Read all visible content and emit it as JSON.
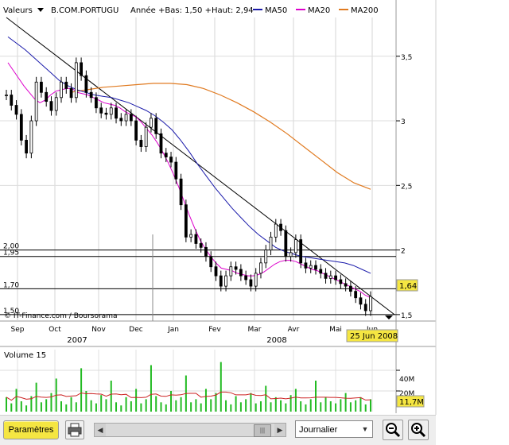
{
  "header": {
    "menu_label": "Valeurs",
    "symbol": "B.COM.PORTUGU",
    "range_text": "Année +Bas: 1,50 +Haut: 2,94",
    "ma50_label": "MA50",
    "ma20_label": "MA20",
    "ma200_label": "MA200"
  },
  "colors": {
    "price": "#000000",
    "ma50": "#1a1aaa",
    "ma20": "#dd00cc",
    "ma200": "#e07a20",
    "volume_bar": "#22bb22",
    "volume_ma": "#cc2222",
    "last_price_box": "#f5e642",
    "date_box": "#f5e642",
    "params_button": "#f5e642"
  },
  "icons": {
    "menu": "triangle-down-icon",
    "print": "printer-icon",
    "zoom_out": "zoom-out-icon",
    "zoom_in": "zoom-in-icon"
  },
  "chart_data": {
    "type": "line",
    "ylim": [
      1.45,
      3.8
    ],
    "y_ticks": [
      {
        "v": 3.5,
        "label": "3,5"
      },
      {
        "v": 3.0,
        "label": "3"
      },
      {
        "v": 2.5,
        "label": "2,5"
      },
      {
        "v": 2.0,
        "label": "2"
      },
      {
        "v": 1.5,
        "label": "1,5"
      }
    ],
    "h_levels": [
      {
        "v": 2.0,
        "label": "2,00"
      },
      {
        "v": 1.95,
        "label": "1,95"
      },
      {
        "v": 1.7,
        "label": "1,70"
      },
      {
        "v": 1.5,
        "label": "1,50"
      }
    ],
    "x_months": [
      "Sep",
      "Oct",
      "Nov",
      "Dec",
      "Jan",
      "Fev",
      "Mar",
      "Avr",
      "Mai",
      "Jun"
    ],
    "x_years": [
      {
        "label": "2007",
        "month_index": 1
      },
      {
        "label": "2008",
        "month_index": 6
      }
    ],
    "last_price_label": "1,64",
    "last_price": 1.64,
    "cursor_date_label": "25 Jun 2008",
    "source_label": "© IT-Finance.com / Boursorama",
    "price_series": {
      "name": "B.COM.PORTUGU",
      "values": [
        3.2,
        3.12,
        3.05,
        2.85,
        2.75,
        3.0,
        3.3,
        3.22,
        3.15,
        3.08,
        3.18,
        3.3,
        3.25,
        3.18,
        3.45,
        3.35,
        3.22,
        3.18,
        3.1,
        3.06,
        3.05,
        3.1,
        3.02,
        3.0,
        3.05,
        3.0,
        2.85,
        2.8,
        2.95,
        3.02,
        2.9,
        2.75,
        2.72,
        2.68,
        2.55,
        2.35,
        2.1,
        2.12,
        2.05,
        2.02,
        1.95,
        1.87,
        1.8,
        1.72,
        1.8,
        1.87,
        1.85,
        1.8,
        1.77,
        1.72,
        1.82,
        1.9,
        2.0,
        2.1,
        2.2,
        2.15,
        1.95,
        1.98,
        2.08,
        1.9,
        1.86,
        1.88,
        1.85,
        1.82,
        1.78,
        1.8,
        1.77,
        1.74,
        1.72,
        1.68,
        1.63,
        1.58,
        1.53,
        1.64
      ]
    },
    "ma20": {
      "name": "MA20",
      "values": [
        3.45,
        3.39,
        3.33,
        3.27,
        3.22,
        3.17,
        3.14,
        3.16,
        3.2,
        3.23,
        3.24,
        3.25,
        3.25,
        3.22,
        3.21,
        3.2,
        3.18,
        3.16,
        3.14,
        3.13,
        3.12,
        3.1,
        3.07,
        3.05,
        3.03,
        2.99,
        2.94,
        2.89,
        2.83,
        2.76,
        2.68,
        2.59,
        2.49,
        2.38,
        2.27,
        2.17,
        2.08,
        2.01,
        1.95,
        1.9,
        1.86,
        1.85,
        1.84,
        1.82,
        1.81,
        1.8,
        1.8,
        1.81,
        1.83,
        1.86,
        1.89,
        1.91,
        1.92,
        1.92,
        1.91,
        1.89,
        1.87,
        1.85,
        1.84,
        1.82,
        1.8,
        1.78,
        1.76,
        1.74,
        1.72,
        1.7,
        1.68,
        1.65,
        1.63
      ]
    },
    "ma50": {
      "name": "MA50",
      "values": [
        3.65,
        3.6,
        3.55,
        3.49,
        3.43,
        3.37,
        3.31,
        3.27,
        3.24,
        3.22,
        3.2,
        3.19,
        3.18,
        3.16,
        3.14,
        3.11,
        3.08,
        3.04,
        2.99,
        2.93,
        2.85,
        2.76,
        2.66,
        2.57,
        2.48,
        2.4,
        2.32,
        2.25,
        2.18,
        2.12,
        2.07,
        2.02,
        1.99,
        1.97,
        1.95,
        1.94,
        1.93,
        1.92,
        1.91,
        1.9,
        1.88,
        1.85,
        1.82
      ]
    },
    "ma200": {
      "name": "MA200",
      "values": [
        3.22,
        3.24,
        3.26,
        3.27,
        3.28,
        3.29,
        3.29,
        3.28,
        3.25,
        3.2,
        3.14,
        3.07,
        2.99,
        2.9,
        2.8,
        2.7,
        2.6,
        2.52,
        2.47
      ]
    },
    "trendline": {
      "from": [
        0.0,
        3.8
      ],
      "to": [
        1.0,
        1.5
      ]
    },
    "volume": {
      "title": "Volume 15",
      "ticks": [
        {
          "label": "40M"
        },
        {
          "label": "20M"
        }
      ],
      "last_label": "11,7M",
      "ylim": [
        0,
        60
      ],
      "values": [
        14,
        8,
        22,
        10,
        6,
        15,
        28,
        9,
        12,
        18,
        32,
        10,
        7,
        14,
        9,
        42,
        20,
        11,
        8,
        16,
        12,
        30,
        9,
        6,
        14,
        10,
        22,
        8,
        12,
        45,
        15,
        9,
        7,
        20,
        11,
        14,
        35,
        9,
        12,
        8,
        22,
        12,
        18,
        48,
        11,
        7,
        15,
        9,
        12,
        18,
        8,
        10,
        25,
        9,
        14,
        11,
        8,
        16,
        22,
        10,
        7,
        12,
        30,
        9,
        14,
        10,
        8,
        12,
        18,
        9,
        11,
        14,
        7,
        12
      ]
    }
  },
  "toolbar": {
    "params_label": "Paramètres",
    "period_value": "Journalier"
  }
}
